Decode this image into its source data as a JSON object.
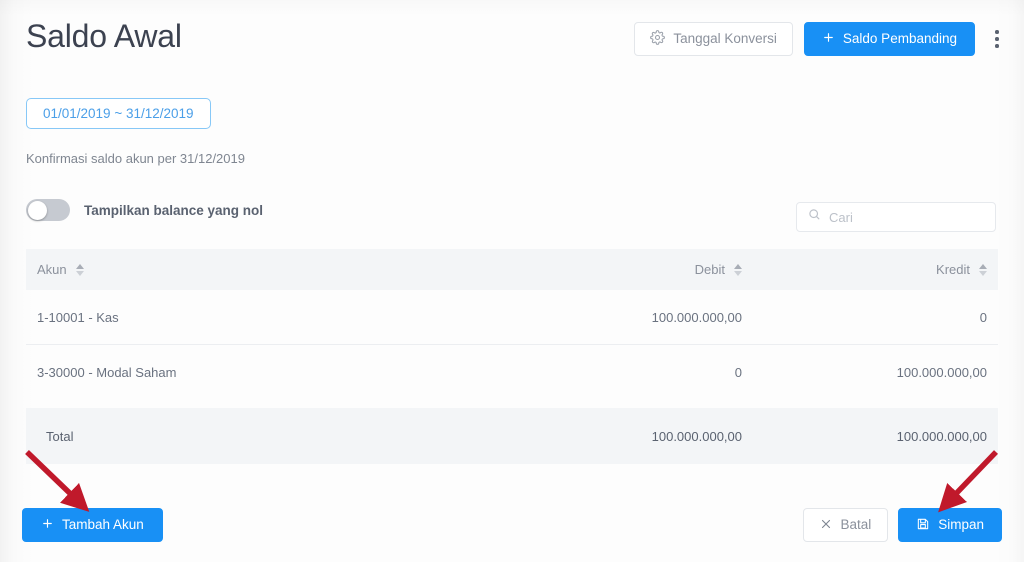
{
  "header": {
    "title": "Saldo Awal",
    "actions": {
      "conversion_date_label": "Tanggal Konversi",
      "conversion_date_icon": "gear-icon",
      "add_comparison_label": "Saldo Pembanding",
      "add_comparison_icon": "plus-icon",
      "more_menu_icon": "kebab-menu-icon"
    }
  },
  "filters": {
    "date_range": "01/01/2019 ~ 31/12/2019",
    "subtitle": "Konfirmasi saldo akun per 31/12/2019",
    "zero_balance_toggle_label": "Tampilkan balance yang nol",
    "zero_balance_toggle_state": "off"
  },
  "search": {
    "placeholder": "Cari",
    "value": "",
    "icon": "search-icon"
  },
  "table": {
    "columns": [
      {
        "key": "akun",
        "label": "Akun",
        "sortable": true
      },
      {
        "key": "debit",
        "label": "Debit",
        "sortable": true
      },
      {
        "key": "kredit",
        "label": "Kredit",
        "sortable": true
      }
    ],
    "rows": [
      {
        "akun": "1-10001 - Kas",
        "debit": "100.000.000,00",
        "kredit": "0"
      },
      {
        "akun": "3-30000 - Modal Saham",
        "debit": "0",
        "kredit": "100.000.000,00"
      }
    ],
    "total": {
      "label": "Total",
      "debit": "100.000.000,00",
      "kredit": "100.000.000,00"
    }
  },
  "footer": {
    "add_account_label": "Tambah Akun",
    "add_account_icon": "plus-icon",
    "cancel_label": "Batal",
    "cancel_icon": "close-icon",
    "save_label": "Simpan",
    "save_icon": "save-icon"
  },
  "annotations": {
    "arrow_color": "#c0192b",
    "arrows": [
      {
        "name": "arrow-to-tambah-akun",
        "points_to": "Tambah Akun"
      },
      {
        "name": "arrow-to-simpan",
        "points_to": "Simpan"
      }
    ]
  },
  "colors": {
    "primary": "#1890f5",
    "date_pill_border": "#87c8f7",
    "date_pill_text": "#4b9fe8",
    "table_header_bg": "#f3f5f7",
    "text": "#5a6270",
    "annotation_red": "#c0192b"
  }
}
